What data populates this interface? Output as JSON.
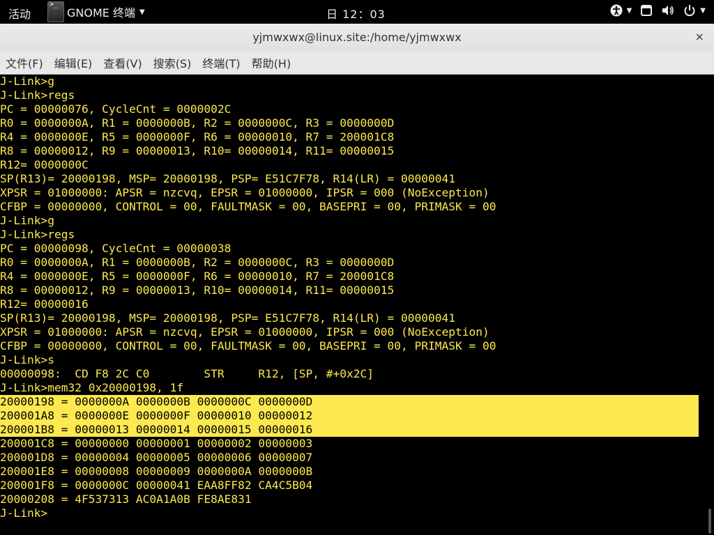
{
  "topbar": {
    "activities": "活动",
    "app_name": "GNOME 终端",
    "clock": "日 12：03"
  },
  "window": {
    "title": "yjmwxwx@linux.site:/home/yjmwxwx",
    "close_symbol": "×"
  },
  "menu": [
    {
      "label": "文件(F)"
    },
    {
      "label": "编辑(E)"
    },
    {
      "label": "查看(V)"
    },
    {
      "label": "搜索(S)"
    },
    {
      "label": "终端(T)"
    },
    {
      "label": "帮助(H)"
    }
  ],
  "terminal": {
    "text_color": "#fce94f",
    "highlight_color": "#fce94f",
    "lines": [
      {
        "text": "J-Link>g"
      },
      {
        "text": "J-Link>regs"
      },
      {
        "text": "PC = 00000076, CycleCnt = 0000002C"
      },
      {
        "text": "R0 = 0000000A, R1 = 0000000B, R2 = 0000000C, R3 = 0000000D"
      },
      {
        "text": "R4 = 0000000E, R5 = 0000000F, R6 = 00000010, R7 = 200001C8"
      },
      {
        "text": "R8 = 00000012, R9 = 00000013, R10= 00000014, R11= 00000015"
      },
      {
        "text": "R12= 0000000C"
      },
      {
        "text": "SP(R13)= 20000198, MSP= 20000198, PSP= E51C7F78, R14(LR) = 00000041"
      },
      {
        "text": "XPSR = 01000000: APSR = nzcvq, EPSR = 01000000, IPSR = 000 (NoException)"
      },
      {
        "text": "CFBP = 00000000, CONTROL = 00, FAULTMASK = 00, BASEPRI = 00, PRIMASK = 00"
      },
      {
        "text": "J-Link>g"
      },
      {
        "text": "J-Link>regs"
      },
      {
        "text": "PC = 00000098, CycleCnt = 00000038"
      },
      {
        "text": "R0 = 0000000A, R1 = 0000000B, R2 = 0000000C, R3 = 0000000D"
      },
      {
        "text": "R4 = 0000000E, R5 = 0000000F, R6 = 00000010, R7 = 200001C8"
      },
      {
        "text": "R8 = 00000012, R9 = 00000013, R10= 00000014, R11= 00000015"
      },
      {
        "text": "R12= 00000016"
      },
      {
        "text": "SP(R13)= 20000198, MSP= 20000198, PSP= E51C7F78, R14(LR) = 00000041"
      },
      {
        "text": "XPSR = 01000000: APSR = nzcvq, EPSR = 01000000, IPSR = 000 (NoException)"
      },
      {
        "text": "CFBP = 00000000, CONTROL = 00, FAULTMASK = 00, BASEPRI = 00, PRIMASK = 00"
      },
      {
        "text": "J-Link>s"
      },
      {
        "text": "00000098:  CD F8 2C C0        STR     R12, [SP, #+0x2C]"
      },
      {
        "text": "J-Link>mem32 0x20000198, 1f"
      },
      {
        "text": "20000198 = 0000000A 0000000B 0000000C 0000000D",
        "highlight": true
      },
      {
        "text": "200001A8 = 0000000E 0000000F 00000010 00000012",
        "highlight": true
      },
      {
        "text": "200001B8 = 00000013 00000014 00000015 00000016",
        "highlight": true
      },
      {
        "text": "200001C8 = 00000000 00000001 00000002 00000003"
      },
      {
        "text": "200001D8 = 00000004 00000005 00000006 00000007"
      },
      {
        "text": "200001E8 = 00000008 00000009 0000000A 0000000B"
      },
      {
        "text": "200001F8 = 0000000C 00000041 EAA8FF82 CA4C5B04"
      },
      {
        "text": "20000208 = 4F537313 AC0A1A0B FE8AE831"
      },
      {
        "text": "J-Link>"
      }
    ]
  },
  "icons": {
    "app": "terminal-icon",
    "accessibility": "accessibility-icon",
    "window_list": "window-icon",
    "volume": "volume-icon",
    "power": "power-icon"
  }
}
